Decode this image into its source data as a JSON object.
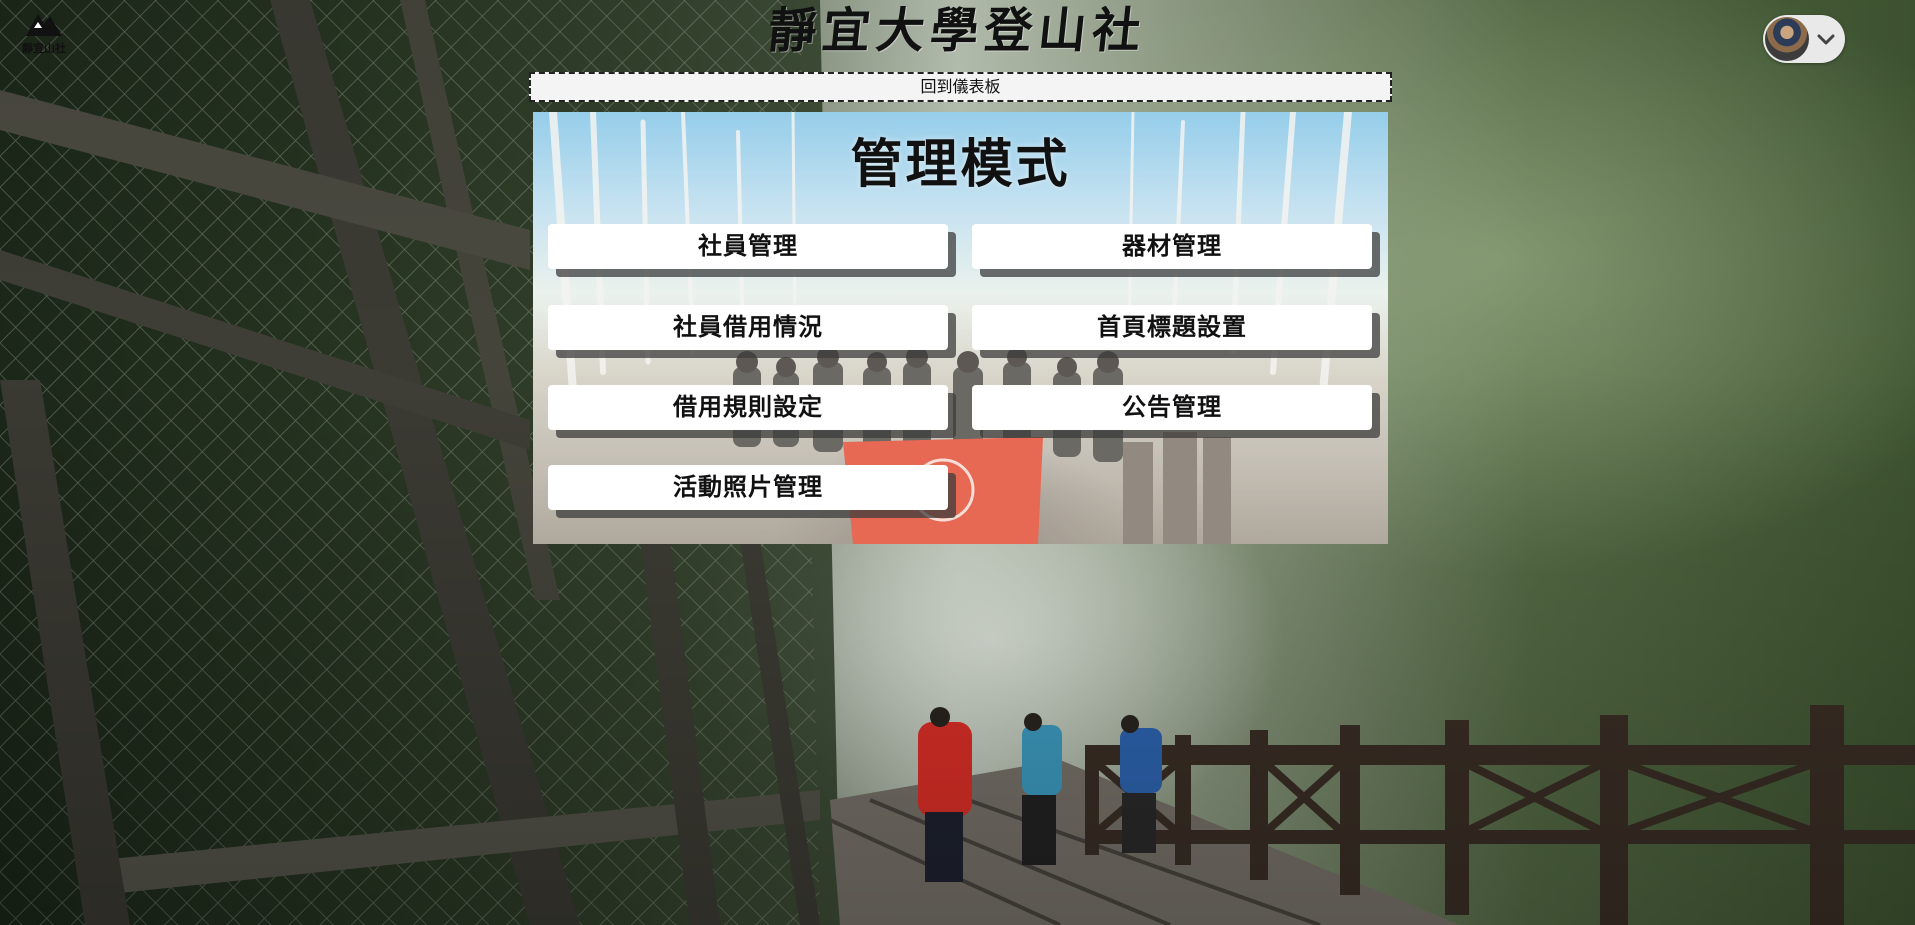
{
  "header": {
    "site_title": "靜宜大學登山社",
    "logo_text": "靜宜山社"
  },
  "nav": {
    "back_label": "回到儀表板"
  },
  "panel": {
    "title": "管理模式",
    "buttons": [
      {
        "label": "社員管理"
      },
      {
        "label": "器材管理"
      },
      {
        "label": "社員借用情況"
      },
      {
        "label": "首頁標題設置"
      },
      {
        "label": "借用規則設定"
      },
      {
        "label": "公告管理"
      },
      {
        "label": "活動照片管理"
      }
    ]
  },
  "icons": {
    "logo": "mountain-club-logo-icon",
    "avatar": "user-avatar",
    "dropdown": "chevron-down-icon"
  },
  "colors": {
    "button_bg": "#ffffff",
    "button_shadow": "#3c3c3c",
    "text": "#111111",
    "banner_flag": "#e2472e"
  }
}
